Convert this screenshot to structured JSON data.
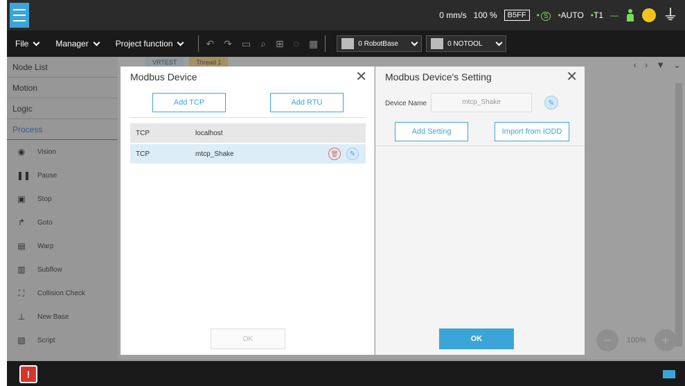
{
  "topbar": {
    "speed": "0 mm/s",
    "percent": "100 %",
    "code": "B5FF",
    "safety_symbol": "S",
    "mode": "AUTO",
    "mode_level": "T1"
  },
  "menubar": {
    "file": "File",
    "manager": "Manager",
    "project_function": "Project function",
    "base_select": "0 RobotBase",
    "tool_select": "0 NOTOOL"
  },
  "left_panel": {
    "header": "Node List",
    "categories": [
      "Motion",
      "Logic",
      "Process"
    ],
    "items": [
      {
        "icon": "eye-icon",
        "label": "Vision"
      },
      {
        "icon": "pause-icon",
        "label": "Pause"
      },
      {
        "icon": "stop-icon",
        "label": "Stop"
      },
      {
        "icon": "goto-icon",
        "label": "Goto"
      },
      {
        "icon": "warp-icon",
        "label": "Warp"
      },
      {
        "icon": "subflow-icon",
        "label": "Subflow"
      },
      {
        "icon": "collision-icon",
        "label": "Collision Check"
      },
      {
        "icon": "base-icon",
        "label": "New Base"
      },
      {
        "icon": "script-icon",
        "label": "Script"
      }
    ]
  },
  "editor": {
    "tabs": [
      "VRTEST",
      "Thread 1"
    ],
    "zoom": "100%"
  },
  "modbus_dialog": {
    "title": "Modbus Device",
    "add_tcp": "Add TCP",
    "add_rtu": "Add RTU",
    "devices": [
      {
        "type": "TCP",
        "name": "localhost"
      },
      {
        "type": "TCP",
        "name": "mtcp_Shake"
      }
    ],
    "ok": "OK"
  },
  "setting_dialog": {
    "title": "Modbus Device's Setting",
    "device_name_label": "Device Name",
    "device_name_value": "mtcp_Shake",
    "add_setting": "Add Setting",
    "import_iodd": "Import from IODD",
    "ok": "OK"
  },
  "colors": {
    "accent": "#3ca5d8",
    "warning": "#d9342b",
    "status_green": "#7ed957",
    "status_yellow": "#f4c21d"
  }
}
